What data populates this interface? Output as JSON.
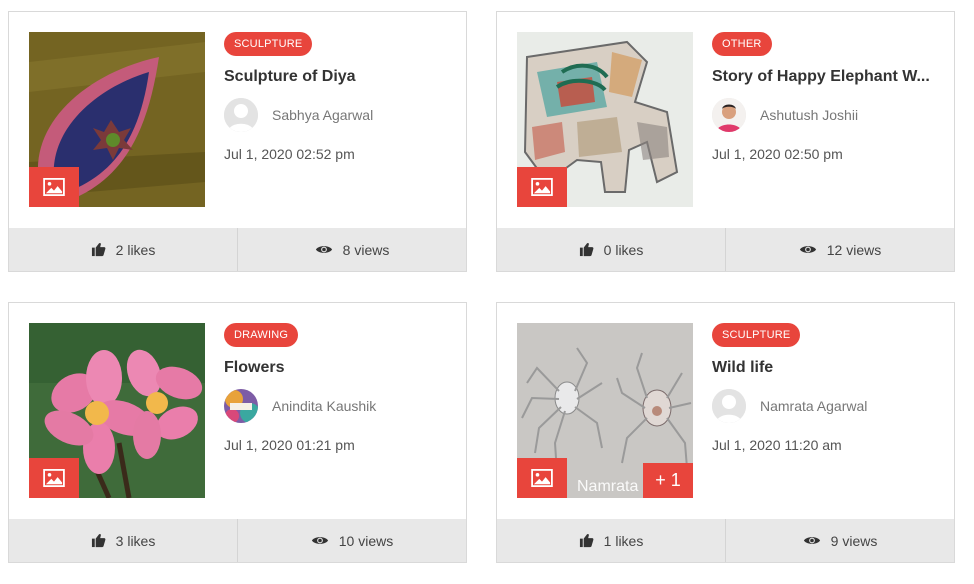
{
  "colors": {
    "accent": "#e8453c",
    "footer_bg": "#e8e8e8"
  },
  "cards": [
    {
      "category": "SCULPTURE",
      "title": "Sculpture of Diya",
      "author": "Sabhya Agarwal",
      "date": "Jul 1, 2020 02:52 pm",
      "likes": "2 likes",
      "views": "8 views",
      "image_icon": "image-icon",
      "avatar": "default-avatar"
    },
    {
      "category": "OTHER",
      "title": "Story of Happy Elephant W...",
      "author": "Ashutush Joshii",
      "date": "Jul 1, 2020 02:50 pm",
      "likes": "0 likes",
      "views": "12 views",
      "image_icon": "image-icon",
      "avatar": "photo-avatar"
    },
    {
      "category": "DRAWING",
      "title": "Flowers",
      "author": "Anindita Kaushik",
      "date": "Jul 1, 2020 01:21 pm",
      "likes": "3 likes",
      "views": "10 views",
      "image_icon": "image-icon",
      "avatar": "photo-avatar"
    },
    {
      "category": "SCULPTURE",
      "title": "Wild life",
      "author": "Namrata Agarwal",
      "date": "Jul 1, 2020 11:20 am",
      "likes": "1 likes",
      "views": "9 views",
      "image_icon": "image-icon",
      "avatar": "default-avatar",
      "watermark": "Namrata",
      "more_count": "+ 1"
    }
  ]
}
